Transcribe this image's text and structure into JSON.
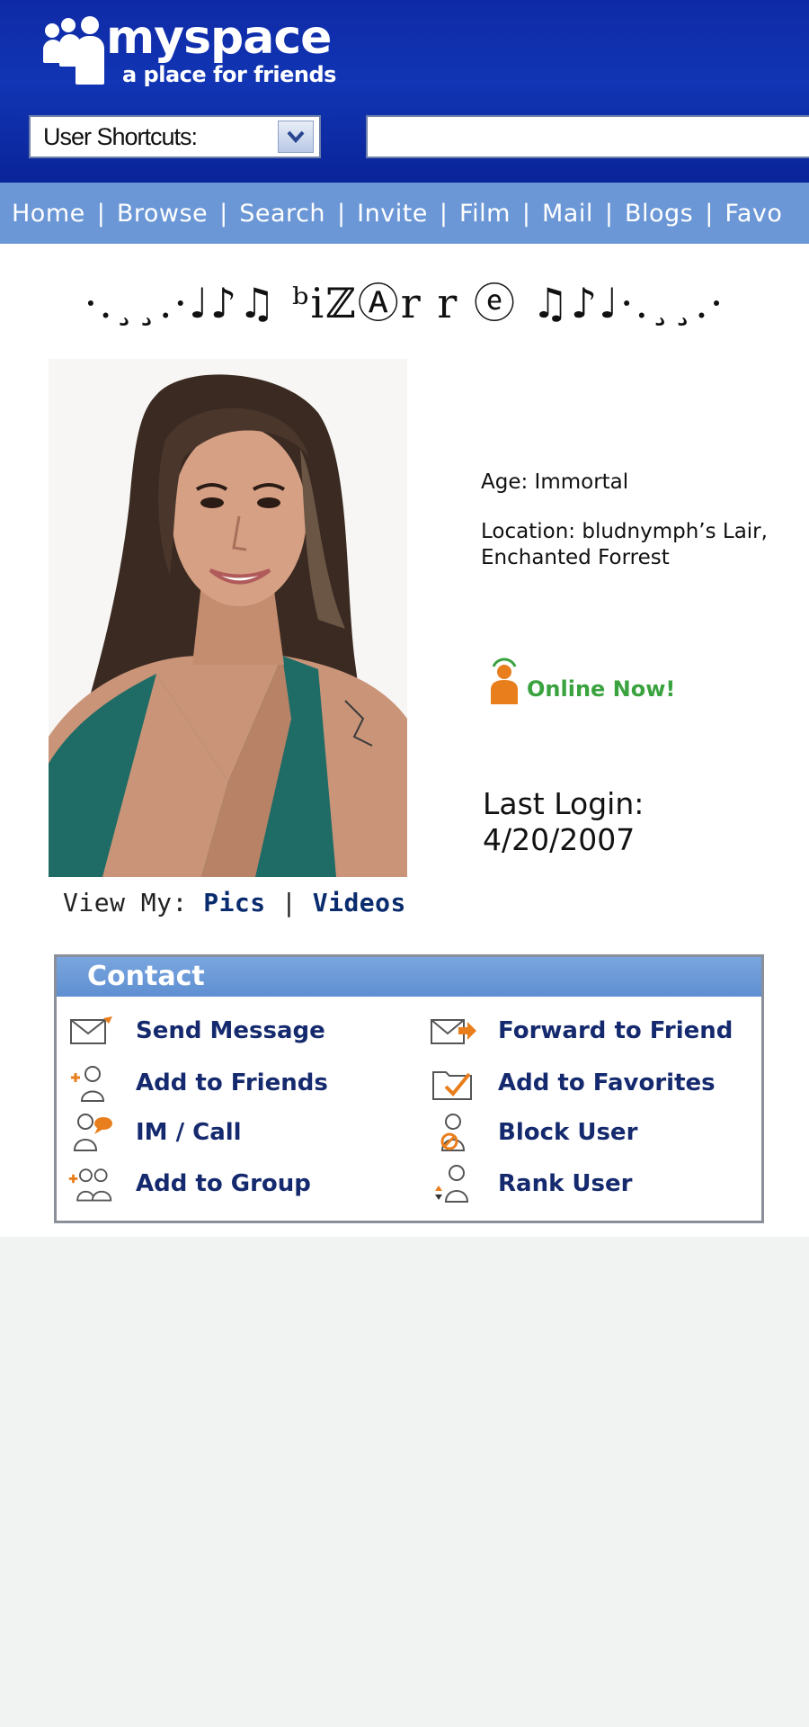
{
  "brand": {
    "name": "myspace",
    "tagline": "a place for friends",
    "header_color": "#1135b4",
    "nav_color": "#6b97d6"
  },
  "shortcuts": {
    "label": "User Shortcuts:"
  },
  "nav": {
    "items": [
      "Home",
      "Browse",
      "Search",
      "Invite",
      "Film",
      "Mail",
      "Blogs",
      "Favo"
    ],
    "separator": "|"
  },
  "profile": {
    "title": "·.¸¸.·♩♪♫ ᵇiℤⒶr r ⓔ ♫♪♩·.¸¸.·",
    "age": "Age: Immortal",
    "location": "Location: bludnymph’s Lair, Enchanted Forrest",
    "online_status": "Online Now!",
    "last_login_label": "Last Login:",
    "last_login_date": "4/20/2007",
    "photo_icon": "profile-photo"
  },
  "view_my": {
    "label": "View My:",
    "pics": "Pics",
    "separator": "|",
    "videos": "Videos"
  },
  "contact": {
    "title": "Contact",
    "items": [
      {
        "label": "Send Message",
        "icon": "envelope-icon"
      },
      {
        "label": "Forward to Friend",
        "icon": "forward-envelope-icon"
      },
      {
        "label": "Add to Friends",
        "icon": "add-friend-icon"
      },
      {
        "label": "Add to Favorites",
        "icon": "favorites-folder-icon"
      },
      {
        "label": "IM / Call",
        "icon": "im-call-icon"
      },
      {
        "label": "Block User",
        "icon": "block-user-icon"
      },
      {
        "label": "Add to Group",
        "icon": "add-group-icon"
      },
      {
        "label": "Rank User",
        "icon": "rank-user-icon"
      }
    ]
  }
}
